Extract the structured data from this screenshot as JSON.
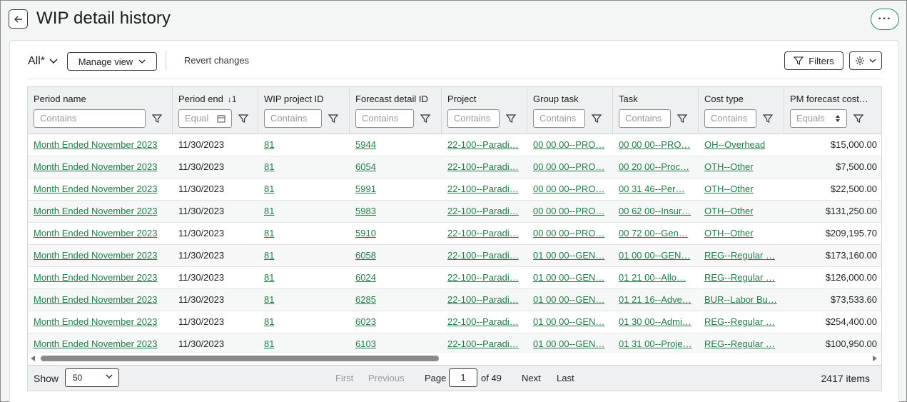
{
  "header": {
    "title": "WIP detail history",
    "back_icon": "arrow-left-icon",
    "more_icon": "more-horizontal-icon"
  },
  "toolbar": {
    "view_label": "All*",
    "manage_view_label": "Manage view",
    "revert_label": "Revert changes",
    "filters_label": "Filters"
  },
  "columns": [
    {
      "label": "Period name",
      "placeholder": "Contains"
    },
    {
      "label": "Period end",
      "placeholder": "Equal",
      "sort": "↓1"
    },
    {
      "label": "WIP project ID",
      "placeholder": "Contains"
    },
    {
      "label": "Forecast detail ID",
      "placeholder": "Contains"
    },
    {
      "label": "Project",
      "placeholder": "Contains"
    },
    {
      "label": "Group task",
      "placeholder": "Contains"
    },
    {
      "label": "Task",
      "placeholder": "Contains"
    },
    {
      "label": "Cost type",
      "placeholder": "Contains"
    },
    {
      "label": "PM forecast cost…",
      "placeholder": "Equals"
    }
  ],
  "rows": [
    [
      "Month Ended November 2023",
      "11/30/2023",
      "81",
      "5944",
      "22-100--Paradi…",
      "00 00 00--PRO…",
      "00 00 00--PRO…",
      "OH--Overhead",
      "$15,000.00"
    ],
    [
      "Month Ended November 2023",
      "11/30/2023",
      "81",
      "6054",
      "22-100--Paradi…",
      "00 00 00--PRO…",
      "00 20 00--Proc…",
      "OTH--Other",
      "$7,500.00"
    ],
    [
      "Month Ended November 2023",
      "11/30/2023",
      "81",
      "5991",
      "22-100--Paradi…",
      "00 00 00--PRO…",
      "00 31 46--Per…",
      "OTH--Other",
      "$22,500.00"
    ],
    [
      "Month Ended November 2023",
      "11/30/2023",
      "81",
      "5983",
      "22-100--Paradi…",
      "00 00 00--PRO…",
      "00 62 00--Insur…",
      "OTH--Other",
      "$131,250.00"
    ],
    [
      "Month Ended November 2023",
      "11/30/2023",
      "81",
      "5910",
      "22-100--Paradi…",
      "00 00 00--PRO…",
      "00 72 00--Gen…",
      "OTH--Other",
      "$209,195.70"
    ],
    [
      "Month Ended November 2023",
      "11/30/2023",
      "81",
      "6058",
      "22-100--Paradi…",
      "01 00 00--GEN…",
      "01 00 00--GEN…",
      "REG--Regular …",
      "$173,160.00"
    ],
    [
      "Month Ended November 2023",
      "11/30/2023",
      "81",
      "6024",
      "22-100--Paradi…",
      "01 00 00--GEN…",
      "01 21 00--Allo…",
      "REG--Regular …",
      "$126,000.00"
    ],
    [
      "Month Ended November 2023",
      "11/30/2023",
      "81",
      "6285",
      "22-100--Paradi…",
      "01 00 00--GEN…",
      "01 21 16--Adve…",
      "BUR--Labor Bu…",
      "$73,533.60"
    ],
    [
      "Month Ended November 2023",
      "11/30/2023",
      "81",
      "6023",
      "22-100--Paradi…",
      "01 00 00--GEN…",
      "01 30 00--Admi…",
      "REG--Regular …",
      "$254,400.00"
    ],
    [
      "Month Ended November 2023",
      "11/30/2023",
      "81",
      "6103",
      "22-100--Paradi…",
      "01 00 00--GEN…",
      "01 31 00--Proje…",
      "REG--Regular …",
      "$100,950.00"
    ]
  ],
  "pager": {
    "show_label": "Show",
    "page_size": "50",
    "first_label": "First",
    "previous_label": "Previous",
    "page_label": "Page",
    "current_page": "1",
    "of_label": "of 49",
    "next_label": "Next",
    "last_label": "Last",
    "items_count": "2417 items"
  },
  "colors": {
    "link": "#237a48",
    "accent_border": "#2f8a5a",
    "header_bg": "#eef1f1"
  }
}
